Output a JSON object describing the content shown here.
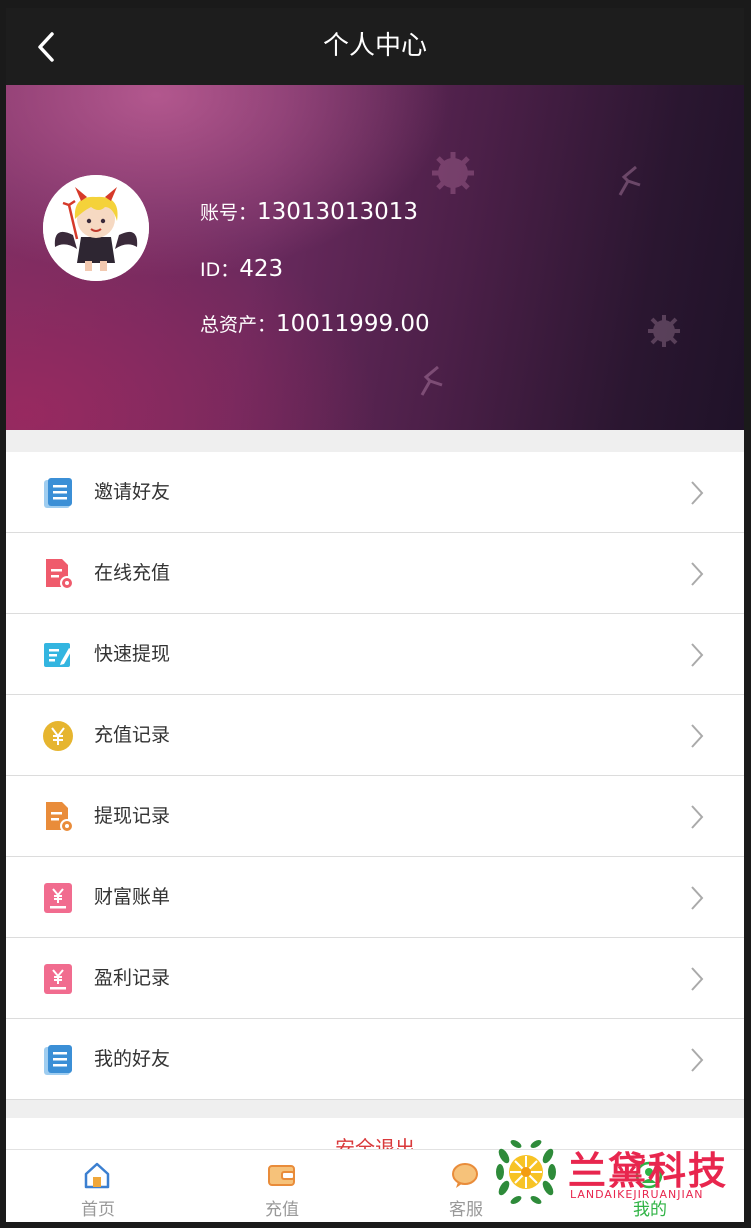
{
  "header": {
    "title": "个人中心",
    "back_icon": "chevron-left-icon"
  },
  "profile": {
    "account_label": "账号：",
    "account_value": "13013013013",
    "id_label": "ID：",
    "id_value": "423",
    "assets_label": "总资产：",
    "assets_value": "10011999.00"
  },
  "menu": {
    "items": [
      {
        "label": "邀请好友",
        "icon": "book-icon",
        "color": "#3b8fd6"
      },
      {
        "label": "在线充值",
        "icon": "document-coin-icon",
        "color": "#ef5b6c"
      },
      {
        "label": "快速提现",
        "icon": "edit-list-icon",
        "color": "#33b5e0"
      },
      {
        "label": "充值记录",
        "icon": "yen-coin-icon",
        "color": "#e6b52f"
      },
      {
        "label": "提现记录",
        "icon": "document-coin-icon",
        "color": "#e98c3a"
      },
      {
        "label": "财富账单",
        "icon": "yen-receipt-icon",
        "color": "#f16c8f"
      },
      {
        "label": "盈利记录",
        "icon": "yen-receipt-icon",
        "color": "#f16c8f"
      },
      {
        "label": "我的好友",
        "icon": "book-icon",
        "color": "#3b8fd6"
      }
    ]
  },
  "logout": {
    "label": "安全退出"
  },
  "tabbar": {
    "tabs": [
      {
        "label": "首页",
        "icon": "home-icon"
      },
      {
        "label": "充值",
        "icon": "wallet-icon"
      },
      {
        "label": "客服",
        "icon": "chat-icon"
      },
      {
        "label": "我的",
        "icon": "user-icon",
        "active": true
      }
    ],
    "active_color": "#2fb344"
  },
  "watermark": {
    "main": "兰黛科技",
    "sub": "LANDAIKEJIRUANJIAN"
  }
}
